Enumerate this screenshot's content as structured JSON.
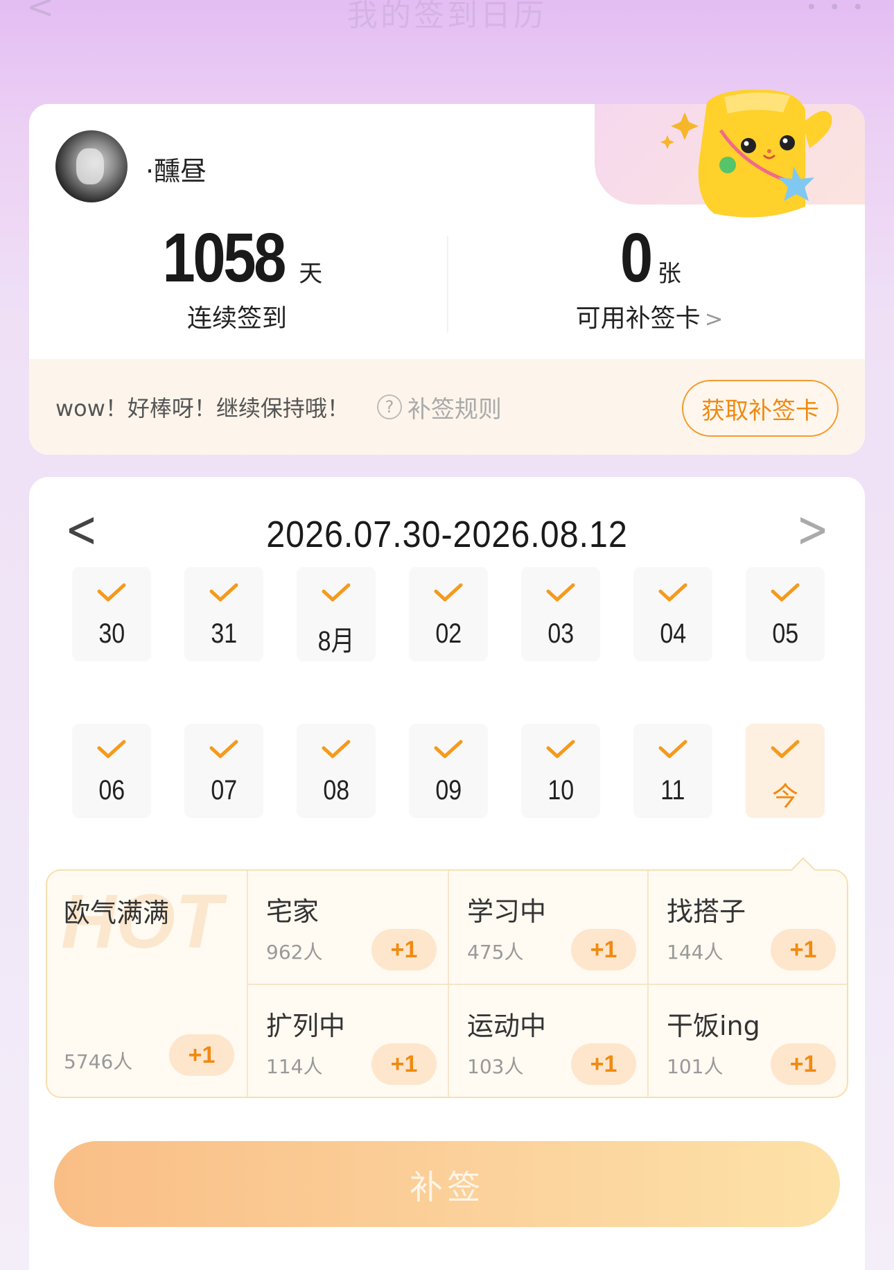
{
  "topbar": {
    "back": "<",
    "title": "我的签到日历",
    "more": "• • •"
  },
  "user": {
    "name": "·醺昼"
  },
  "stats": {
    "streak_value": "1058",
    "streak_unit": "天",
    "streak_label": "连续签到",
    "cards_value": "0",
    "cards_unit": "张",
    "cards_label": "可用补签卡",
    "cards_chevron": ">"
  },
  "footer": {
    "message": "wow！好棒呀！继续保持哦！",
    "rule_icon": "?",
    "rule_label": "补签规则",
    "get_card": "获取补签卡"
  },
  "calendar": {
    "prev": "<",
    "next": ">",
    "range": "2026.07.30-2026.08.12",
    "days": [
      {
        "label": "30",
        "checked": true
      },
      {
        "label": "31",
        "checked": true
      },
      {
        "label": "8月",
        "checked": true
      },
      {
        "label": "02",
        "checked": true
      },
      {
        "label": "03",
        "checked": true
      },
      {
        "label": "04",
        "checked": true
      },
      {
        "label": "05",
        "checked": true
      },
      {
        "label": "06",
        "checked": true
      },
      {
        "label": "07",
        "checked": true
      },
      {
        "label": "08",
        "checked": true
      },
      {
        "label": "09",
        "checked": true
      },
      {
        "label": "10",
        "checked": true
      },
      {
        "label": "11",
        "checked": true
      },
      {
        "label": "今",
        "checked": true,
        "today": true
      }
    ]
  },
  "tags": {
    "hot": {
      "bg_text": "HOT",
      "name": "欧气满满",
      "count": "5746人",
      "plus": "+1"
    },
    "items": [
      {
        "name": "宅家",
        "count": "962人",
        "plus": "+1"
      },
      {
        "name": "学习中",
        "count": "475人",
        "plus": "+1"
      },
      {
        "name": "找搭子",
        "count": "144人",
        "plus": "+1"
      },
      {
        "name": "扩列中",
        "count": "114人",
        "plus": "+1"
      },
      {
        "name": "运动中",
        "count": "103人",
        "plus": "+1"
      },
      {
        "name": "干饭ing",
        "count": "101人",
        "plus": "+1"
      }
    ]
  },
  "action": {
    "label": "补签"
  },
  "colors": {
    "accent": "#f08a12",
    "check": "#f59a1c",
    "button_start": "#f9be86",
    "button_end": "#fde2a8"
  }
}
